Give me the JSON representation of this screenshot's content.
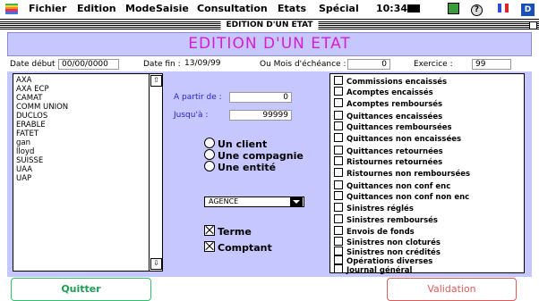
{
  "menubar": {
    "apple": "",
    "items": [
      "Fichier",
      "Edition",
      "Mode",
      "Saisie",
      "Consultation",
      "Etats",
      "Spécial"
    ],
    "clock": "10:34"
  },
  "window": {
    "title": "EDITION D'UN ETAT"
  },
  "heading": "EDITION D'UN ETAT",
  "form": {
    "date_debut_label": "Date début :",
    "date_debut_value": "00/00/0000",
    "date_fin_label": "Date fin :",
    "date_fin_value": "13/09/99",
    "mois_label": "Ou Mois d'échéance :",
    "mois_value": "0",
    "exercice_label": "Exercice :",
    "exercice_value": "99"
  },
  "companies": [
    "AXA",
    "AXA ECP",
    "CAMAT",
    "COMM UNION",
    "DUCLOS",
    "ERABLE",
    "FATET",
    "gan",
    "lloyd",
    "SUISSE",
    "UAA",
    "UAP"
  ],
  "range": {
    "from_label": "A partir de :",
    "from_value": "0",
    "to_label": "Jusqu'à :",
    "to_value": "99999"
  },
  "radios": [
    "Un client",
    "Une compagnie",
    "Une entité"
  ],
  "agence_select": "AGENCE",
  "checks": [
    "Terme",
    "Comptant"
  ],
  "reports": [
    "Commissions encaissés",
    "Acomptes encaissés",
    "Acomptes remboursés",
    "Quittances encaissées",
    "Quittances remboursées",
    "Quittances non encaissées",
    "Quittances retournées",
    "Ristournes retournées",
    "Ristournes non remboursées",
    "Quittances non conf enc",
    "Quittances non conf non enc",
    "Sinistres réglés",
    "Sinistres remboursés",
    "Envois de fonds",
    "Sinistres non cloturés",
    "Sinistres non crédités",
    "Opérations diverses",
    "Journal général"
  ],
  "buttons": {
    "quit": "Quitter",
    "validate": "Validation"
  },
  "colors": {
    "panel": "#c7c7ff",
    "heading_text": "#d61dd6",
    "quit_text": "#1f9d55",
    "validate_text": "#e05a5a"
  }
}
